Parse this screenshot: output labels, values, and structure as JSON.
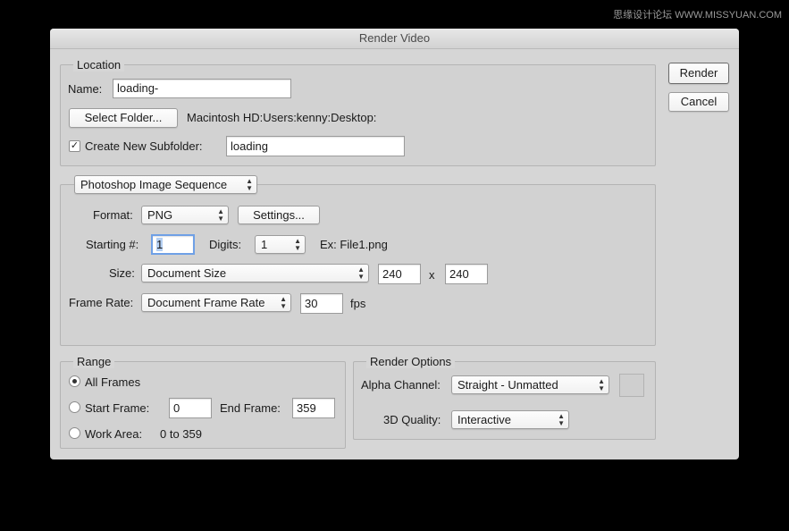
{
  "watermark": "思缘设计论坛 WWW.MISSYUAN.COM",
  "window": {
    "title": "Render Video"
  },
  "actions": {
    "render": "Render",
    "cancel": "Cancel"
  },
  "location": {
    "legend": "Location",
    "name_label": "Name:",
    "name_value": "loading-",
    "select_folder": "Select Folder...",
    "folder_path": "Macintosh HD:Users:kenny:Desktop:",
    "create_subfolder_checked": true,
    "create_subfolder_label": "Create New Subfolder:",
    "subfolder_value": "loading"
  },
  "export": {
    "type_popup": "Photoshop Image Sequence",
    "format_label": "Format:",
    "format_value": "PNG",
    "settings_button": "Settings...",
    "starting_label": "Starting #:",
    "starting_value": "1",
    "digits_label": "Digits:",
    "digits_value": "1",
    "example": "Ex: File1.png",
    "size_label": "Size:",
    "size_value": "Document Size",
    "width": "240",
    "x": "x",
    "height": "240",
    "frame_rate_label": "Frame Rate:",
    "frame_rate_value": "Document Frame Rate",
    "fps_value": "30",
    "fps_unit": "fps"
  },
  "range": {
    "legend": "Range",
    "all_frames": "All Frames",
    "all_frames_selected": true,
    "start_frame_label": "Start Frame:",
    "start_frame_value": "0",
    "end_frame_label": "End Frame:",
    "end_frame_value": "359",
    "work_area_label": "Work Area:",
    "work_area_value": "0 to 359"
  },
  "render_options": {
    "legend": "Render Options",
    "alpha_label": "Alpha Channel:",
    "alpha_value": "Straight - Unmatted",
    "quality_label": "3D Quality:",
    "quality_value": "Interactive"
  },
  "icons": {
    "popup_arrows": "updown-arrows-icon",
    "checkmark": "checkmark-icon"
  }
}
